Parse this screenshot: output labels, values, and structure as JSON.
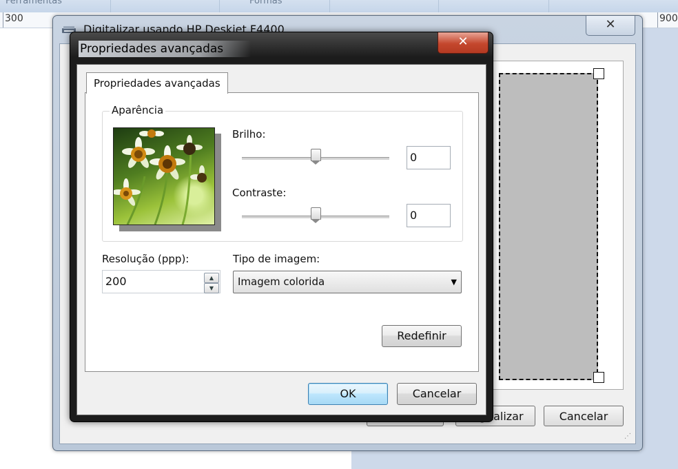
{
  "background_app": {
    "ribbon_labels": [
      "Ferramentas",
      "Formas"
    ],
    "ruler_labels": [
      "300",
      "900"
    ]
  },
  "scan_window": {
    "title": "Digitalizar usando HP Deskjet F4400",
    "close_label": "✕",
    "buttons": {
      "scan_label": "Digitalizar",
      "cancel_label": "Cancelar"
    }
  },
  "dialog": {
    "title": "Propriedades avançadas",
    "close_label": "✕",
    "tab_label": "Propriedades avançadas",
    "appearance": {
      "legend": "Aparência",
      "brightness_label": "Brilho:",
      "brightness_value": "0",
      "brightness_level": 0.5,
      "contrast_label": "Contraste:",
      "contrast_value": "0",
      "contrast_level": 0.5
    },
    "resolution": {
      "label": "Resolução (ppp):",
      "value": "200"
    },
    "image_type": {
      "label": "Tipo de imagem:",
      "selected": "Imagem colorida"
    },
    "reset_label": "Redefinir",
    "ok_label": "OK",
    "cancel_label": "Cancelar"
  },
  "icons": {
    "scanner": "scanner-icon",
    "close": "close-icon",
    "spin_up": "spin-up-icon",
    "spin_down": "spin-down-icon",
    "dropdown": "chevron-down-icon",
    "grip": "resize-grip-icon"
  }
}
